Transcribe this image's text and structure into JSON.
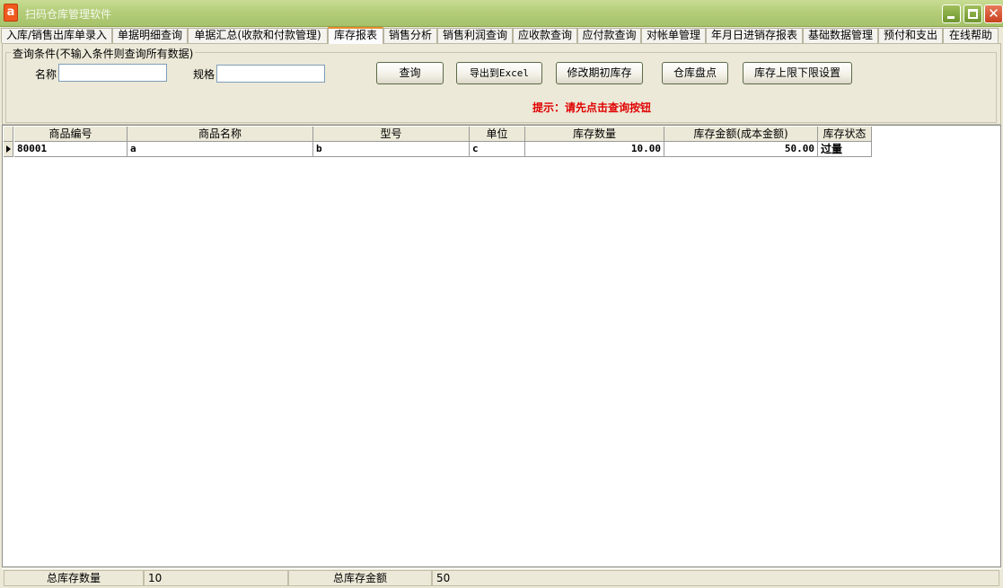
{
  "window": {
    "title": "扫码仓库管理软件",
    "icon_letter": "a"
  },
  "tabs": [
    "入库/销售出库单录入",
    "单据明细查询",
    "单据汇总(收款和付款管理)",
    "库存报表",
    "销售分析",
    "销售利润查询",
    "应收款查询",
    "应付款查询",
    "对帐单管理",
    "年月日进销存报表",
    "基础数据管理",
    "预付和支出",
    "在线帮助"
  ],
  "active_tab": "库存报表",
  "query": {
    "legend": "查询条件(不输入条件则查询所有数据)",
    "name_label": "名称",
    "name_value": "",
    "spec_label": "规格",
    "spec_value": "",
    "buttons": {
      "query": "查询",
      "export": "导出到Excel",
      "edit_initial": "修改期初库存",
      "stocktake": "仓库盘点",
      "limits": "库存上限下限设置"
    },
    "hint": "提示：请先点击查询按钮"
  },
  "grid": {
    "columns": [
      "商品编号",
      "商品名称",
      "型号",
      "单位",
      "库存数量",
      "库存金额(成本金额)",
      "库存状态"
    ],
    "rows": [
      {
        "code": "80001",
        "name": "a",
        "model": "b",
        "unit": "c",
        "qty": "10.00",
        "amount": "50.00",
        "status": "过量"
      }
    ]
  },
  "statusbar": {
    "total_qty_label": "总库存数量",
    "total_qty_value": "10",
    "total_amount_label": "总库存金额",
    "total_amount_value": "50"
  }
}
